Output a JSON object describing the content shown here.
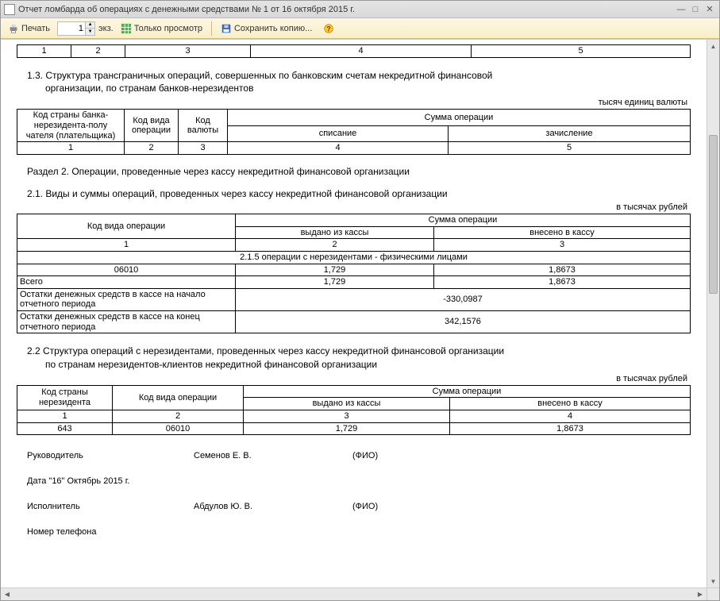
{
  "window": {
    "title": "Отчет ломбарда об операциях с денежными средствами № 1 от 16 октября 2015 г."
  },
  "toolbar": {
    "print": "Печать",
    "copies_value": "1",
    "copies_label": "экз.",
    "preview": "Только просмотр",
    "savecopy": "Сохранить копию..."
  },
  "top_row": {
    "c1": "1",
    "c2": "2",
    "c3": "3",
    "c4": "4",
    "c5": "5"
  },
  "sec13": {
    "title_l1": "1.3. Структура трансграничных операций, совершенных по банковским счетам некредитной финансовой",
    "title_l2": "организации, по странам банков-нерезидентов",
    "unit": "тысяч единиц валюты",
    "h1": "Код страны банка-нерезидента-полу чателя (плательщика)",
    "h2": "Код вида операции",
    "h3": "Код валюты",
    "h4": "Сумма операции",
    "h4a": "списание",
    "h4b": "зачисление",
    "n1": "1",
    "n2": "2",
    "n3": "3",
    "n4": "4",
    "n5": "5"
  },
  "sec2": {
    "title": "Раздел 2. Операции, проведенные через кассу некредитной финансовой организации"
  },
  "sec21": {
    "title": "2.1. Виды и суммы операций, проведенных через кассу некредитной финансовой организации",
    "unit": "в тысячах рублей",
    "h1": "Код вида операции",
    "h2": "Сумма операции",
    "h2a": "выдано из кассы",
    "h2b": "внесено в кассу",
    "n1": "1",
    "n2": "2",
    "n3": "3",
    "grp": "2.1.5 операции с нерезидентами - физическими лицами",
    "r1c1": "06010",
    "r1c2": "1,729",
    "r1c3": "1,8673",
    "r2c1": "Всего",
    "r2c2": "1,729",
    "r2c3": "1,8673",
    "r3c1": "Остатки денежных средств в кассе на начало отчетного периода",
    "r3val": "-330,0987",
    "r4c1": "Остатки денежных средств в кассе на конец отчетного периода",
    "r4val": "342,1576"
  },
  "sec22": {
    "title_l1": "2.2 Структура операций с нерезидентами, проведенных через кассу некредитной финансовой организации",
    "title_l2": "по странам нерезидентов-клиентов некредитной финансовой организации",
    "unit": "в тысячах рублей",
    "h1": "Код страны нерезидента",
    "h2": "Код вида операции",
    "h3": "Сумма операции",
    "h3a": "выдано из кассы",
    "h3b": "внесено в кассу",
    "n1": "1",
    "n2": "2",
    "n3": "3",
    "n4": "4",
    "r1c1": "643",
    "r1c2": "06010",
    "r1c3": "1,729",
    "r1c4": "1,8673"
  },
  "sig": {
    "head_lbl": "Руководитель",
    "head_name": "Семенов Е. В.",
    "fio": "(ФИО)",
    "date": "Дата \"16\" Октябрь 2015 г.",
    "exec_lbl": "Исполнитель",
    "exec_name": "Абдулов Ю. В.",
    "phone_lbl": "Номер телефона"
  }
}
